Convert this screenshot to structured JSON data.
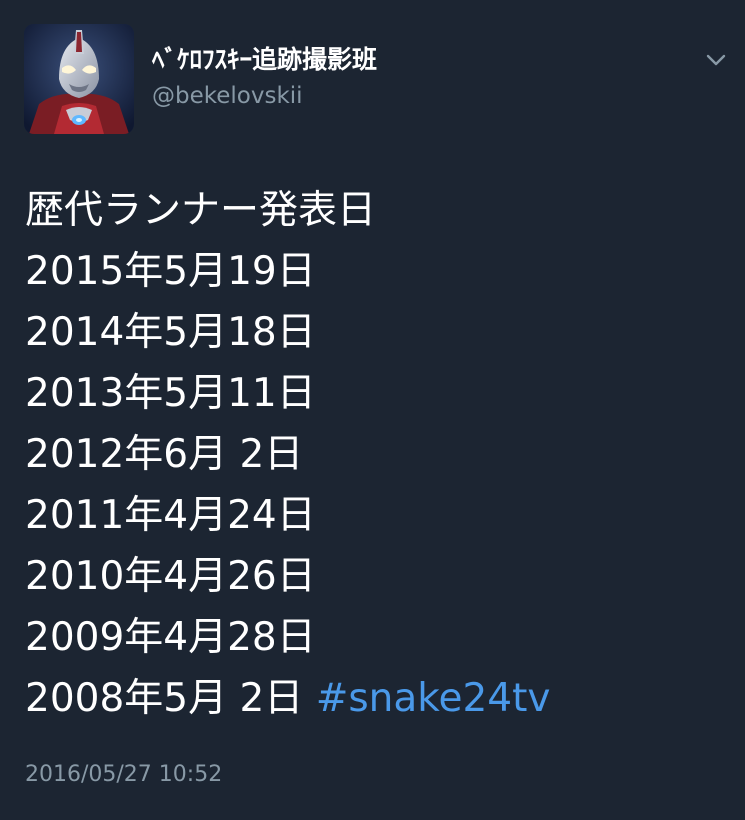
{
  "tweet": {
    "avatar_icon": "ultraman-avatar",
    "display_name": "ﾍﾞｹﾛﾌｽｷｰ追跡撮影班",
    "handle": "@bekelovskii",
    "menu_icon": "chevron-down-icon",
    "lines": [
      "歴代ランナー発表日",
      "2015年5月19日",
      "2014年5月18日",
      "2013年5月11日",
      "2012年6月 2日",
      "2011年4月24日",
      "2010年4月26日",
      "2009年4月28日",
      "2008年5月 2日"
    ],
    "hashtag": "#snake24tv",
    "timestamp": "2016/05/27 10:52"
  },
  "colors": {
    "background": "#1c2532",
    "text": "#ffffff",
    "secondary": "#8899a6",
    "link": "#4a99e9"
  }
}
